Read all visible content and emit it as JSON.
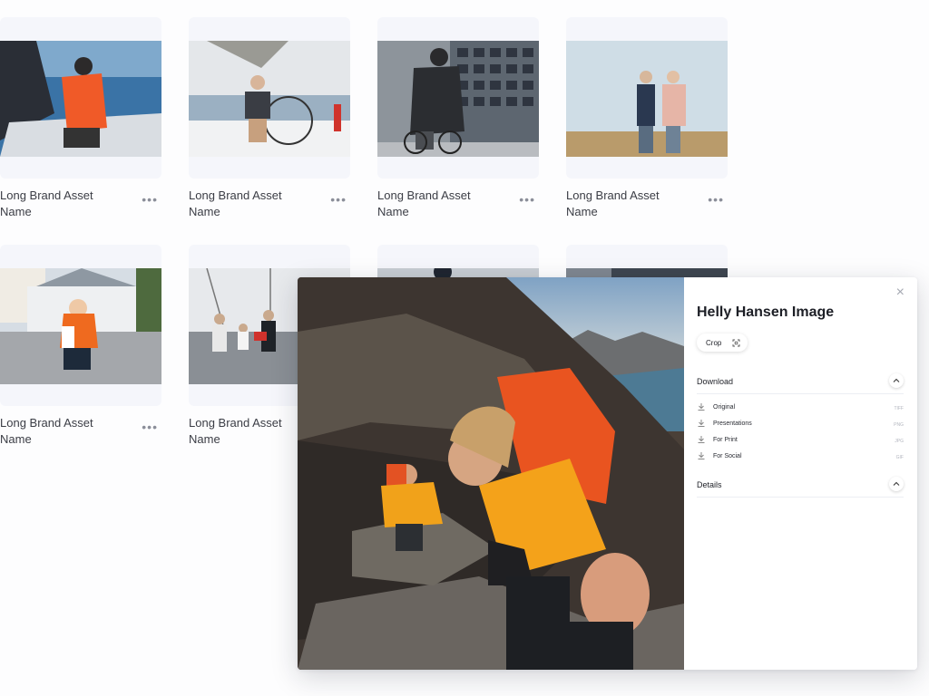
{
  "grid": {
    "cards": [
      {
        "caption_line1": "Long Brand Asset",
        "caption_line2": "Name",
        "more": "•••",
        "scene": "sailing-red-jacket"
      },
      {
        "caption_line1": "Long Brand Asset",
        "caption_line2": "Name",
        "more": "•••",
        "scene": "sailing-wheel"
      },
      {
        "caption_line1": "Long Brand Asset",
        "caption_line2": "Name",
        "more": "•••",
        "scene": "city-cyclist"
      },
      {
        "caption_line1": "Long Brand Asset",
        "caption_line2": "Name",
        "more": "•••",
        "scene": "couple-field"
      },
      {
        "caption_line1": "Long Brand Asset",
        "caption_line2": "Name",
        "more": "•••",
        "scene": "child-orange-jacket"
      },
      {
        "caption_line1": "Long Brand Asset",
        "caption_line2": "Name",
        "more": "",
        "scene": "family-dock"
      },
      {
        "caption_line1": "",
        "caption_line2": "",
        "more": "",
        "scene": "partial-portrait"
      },
      {
        "caption_line1": "",
        "caption_line2": "",
        "more": "",
        "scene": "partial-building"
      }
    ]
  },
  "modal": {
    "title": "Helly Hansen Image",
    "close_icon": "×",
    "crop_label": "Crop",
    "photo_scene": "hikers-climbing-rock",
    "download": {
      "heading": "Download",
      "items": [
        {
          "label": "Original",
          "format": "TIFF"
        },
        {
          "label": "Presentations",
          "format": "PNG"
        },
        {
          "label": "For Print",
          "format": "JPG"
        },
        {
          "label": "For Social",
          "format": "GIF"
        }
      ]
    },
    "details": {
      "heading": "Details"
    }
  },
  "colors": {
    "card_bg": "#f5f6fb",
    "accent_orange": "#f26a1b",
    "text_dark": "#1d1f26",
    "text_muted": "#8b8e99"
  }
}
